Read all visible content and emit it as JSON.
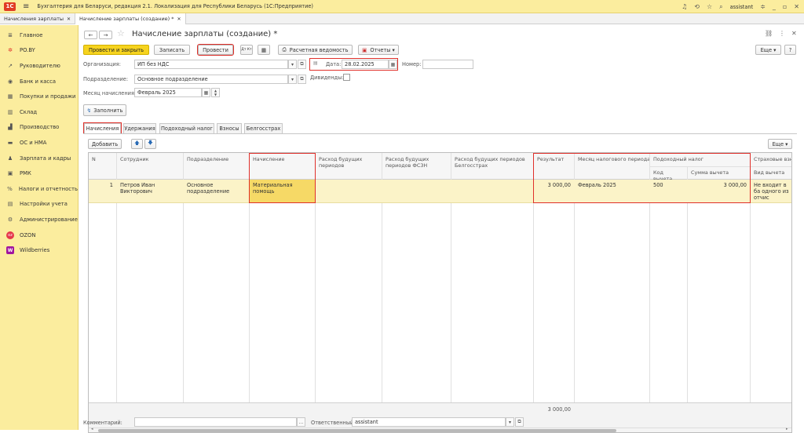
{
  "app": {
    "logo": "1С",
    "title": "Бухгалтерия для Беларуси, редакция 2.1. Локализация для Республики Беларусь (1С:Предприятие)",
    "user": "assistant"
  },
  "window_tabs": [
    {
      "label": "Начисления зарплаты"
    },
    {
      "label": "Начисление зарплаты (создание) *"
    }
  ],
  "sidebar": {
    "items": [
      {
        "label": "Главное",
        "icon": "≣"
      },
      {
        "label": "PO.BY",
        "icon": "✲"
      },
      {
        "label": "Руководителю",
        "icon": "↗"
      },
      {
        "label": "Банк и касса",
        "icon": "◉"
      },
      {
        "label": "Покупки и продажи",
        "icon": "▦"
      },
      {
        "label": "Склад",
        "icon": "▥"
      },
      {
        "label": "Производство",
        "icon": "▟"
      },
      {
        "label": "ОС и НМА",
        "icon": "▬"
      },
      {
        "label": "Зарплата и кадры",
        "icon": "♟"
      },
      {
        "label": "РМК",
        "icon": "▣"
      },
      {
        "label": "Налоги и отчетность",
        "icon": "%"
      },
      {
        "label": "Настройки учета",
        "icon": "▤"
      },
      {
        "label": "Администрирование",
        "icon": "⚙"
      },
      {
        "label": "OZON",
        "icon": "oz"
      },
      {
        "label": "Wildberries",
        "icon": "W"
      }
    ]
  },
  "doc": {
    "title": "Начисление зарплаты (создание) *"
  },
  "toolbar": {
    "post_close": "Провести и закрыть",
    "save": "Записать",
    "post": "Провести",
    "dt_kt": "Дт Кт",
    "payroll": "Расчетная ведомость",
    "reports": "Отчеты ▾",
    "more": "Еще ▾",
    "help": "?"
  },
  "form": {
    "org_label": "Организация:",
    "org_value": "ИП без НДС",
    "date_label": "Дата:",
    "date_value": "28.02.2025",
    "number_label": "Номер:",
    "number_value": "",
    "dept_label": "Подразделение:",
    "dept_value": "Основное подразделение",
    "dividends_label": "Дивиденды:",
    "month_label": "Месяц начисления:",
    "month_value": "Февраль 2025",
    "fill_button": "Заполнить"
  },
  "tabs": [
    {
      "label": "Начисления"
    },
    {
      "label": "Удержания"
    },
    {
      "label": "Подоходный налог"
    },
    {
      "label": "Взносы"
    },
    {
      "label": "Белгосстрах"
    }
  ],
  "table_toolbar": {
    "add": "Добавить",
    "more": "Еще ▾"
  },
  "table": {
    "headers": {
      "n": "N",
      "employee": "Сотрудник",
      "department": "Подразделение",
      "accrual": "Начисление",
      "future": "Расход будущих периодов",
      "future_fszn": "Расход будущих периодов ФСЗН",
      "future_bgs": "Расход будущих периодов Белгосстрах",
      "result": "Результат",
      "tax_month": "Месяц налогового периода",
      "income_tax": "Подоходный налог",
      "deduction_code": "Код вычета",
      "deduction_sum": "Сумма вычета",
      "insurance": "Страховые взн",
      "insurance_type": "Вид вычета"
    },
    "row": {
      "n": "1",
      "employee": "Петров Иван Викторович",
      "department": "Основное подразделение",
      "accrual": "Материальная помощь",
      "future": "",
      "future_fszn": "",
      "future_bgs": "",
      "result": "3 000,00",
      "tax_month": "Февраль 2025",
      "deduction_code": "500",
      "deduction_sum": "3 000,00",
      "insurance_type": "Не входит в ба одного из отчис"
    },
    "total_result": "3 000,00"
  },
  "footer": {
    "comment_label": "Комментарий:",
    "comment_value": "",
    "responsible_label": "Ответственный:",
    "responsible_value": "assistant"
  }
}
